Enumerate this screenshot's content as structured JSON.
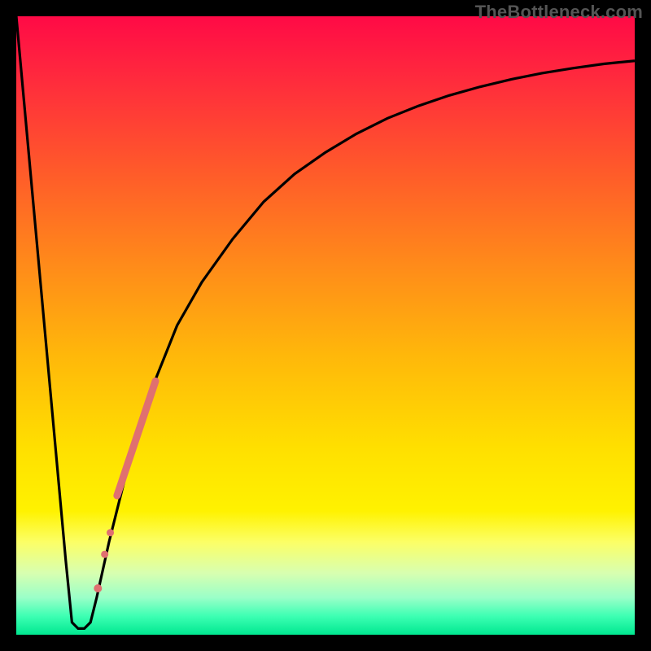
{
  "watermark": "TheBottleneck.com",
  "colors": {
    "frame": "#000000",
    "curve": "#000000",
    "marker": "#e07070",
    "gradient_top": "#ff0a46",
    "gradient_bottom": "#00e890"
  },
  "chart_data": {
    "type": "line",
    "title": "",
    "xlabel": "",
    "ylabel": "",
    "xlim": [
      0,
      100
    ],
    "ylim": [
      0,
      100
    ],
    "grid": false,
    "legend": false,
    "series": [
      {
        "name": "bottleneck-curve",
        "x": [
          0,
          2,
          4,
          6,
          8,
          9,
          10,
          11,
          12,
          13,
          15,
          18,
          22,
          26,
          30,
          35,
          40,
          45,
          50,
          55,
          60,
          65,
          70,
          75,
          80,
          85,
          90,
          95,
          100
        ],
        "y": [
          100,
          78,
          56,
          34,
          12,
          2,
          1,
          1,
          2,
          6,
          15,
          27,
          40,
          50,
          57,
          64,
          70,
          74.5,
          78,
          81,
          83.5,
          85.5,
          87.2,
          88.6,
          89.8,
          90.8,
          91.6,
          92.3,
          92.8
        ]
      }
    ],
    "markers": [
      {
        "name": "highlight-segment",
        "x0": 16.3,
        "y0": 22.5,
        "x1": 22.5,
        "y1": 41.0,
        "width": 9
      },
      {
        "name": "dot-1",
        "cx": 15.2,
        "cy": 16.5,
        "r": 4.5
      },
      {
        "name": "dot-2",
        "cx": 14.3,
        "cy": 13.0,
        "r": 4.5
      },
      {
        "name": "dot-3",
        "cx": 13.2,
        "cy": 7.5,
        "r": 5.0
      }
    ]
  }
}
